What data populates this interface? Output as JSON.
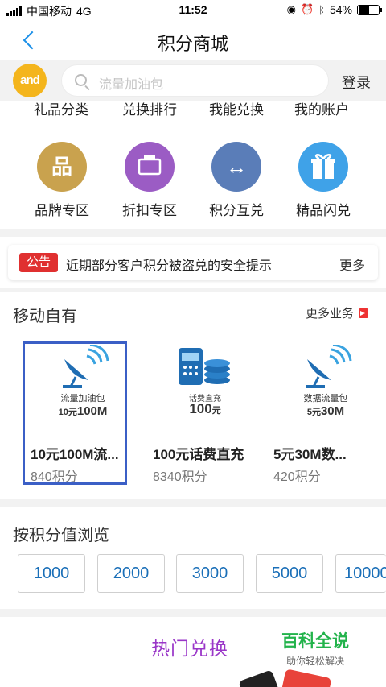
{
  "status_bar": {
    "carrier": "中国移动",
    "network": "4G",
    "time": "11:52",
    "battery_text": "54%",
    "battery_level": 0.54
  },
  "nav": {
    "title": "积分商城"
  },
  "search": {
    "placeholder": "流量加油包",
    "login_label": "登录",
    "logo_text": "and"
  },
  "top_menu": [
    "礼品分类",
    "兑换排行",
    "我能兑换",
    "我的账户"
  ],
  "categories": [
    {
      "label": "品牌专区",
      "color": "#c9a24e",
      "icon": "brand-icon"
    },
    {
      "label": "折扣专区",
      "color": "#9b5cc4",
      "icon": "discount-icon"
    },
    {
      "label": "积分互兑",
      "color": "#5a7db8",
      "icon": "exchange-icon"
    },
    {
      "label": "精品闪兑",
      "color": "#3fa2e8",
      "icon": "gift-icon"
    }
  ],
  "notice": {
    "tag": "公告",
    "text": "近期部分客户积分被盗兑的安全提示",
    "more": "更多"
  },
  "mobile_section": {
    "title": "移动自有",
    "more": "更多业务",
    "items": [
      {
        "caption": "流量加油包",
        "value_small": "10元",
        "value_big": "100M",
        "name": "10元100M流...",
        "points": "840积分"
      },
      {
        "caption": "话费直充",
        "value_small": "元",
        "value_big": "100",
        "name": "100元话费直充",
        "points": "8340积分"
      },
      {
        "caption": "数据流量包",
        "value_small": "5元",
        "value_big": "30M",
        "name": "5元30M数...",
        "points": "420积分"
      }
    ]
  },
  "browse": {
    "title": "按积分值浏览",
    "values": [
      "1000",
      "2000",
      "3000",
      "5000",
      "10000"
    ]
  },
  "hot": {
    "title": "热门兑换"
  },
  "watermark": {
    "main": "百科全说",
    "sub": "助你轻松解决"
  },
  "colors": {
    "accent": "#1a8fe8",
    "notice_tag": "#e03030",
    "hot_title": "#9a36c8",
    "selection": "#3b5fc6"
  }
}
